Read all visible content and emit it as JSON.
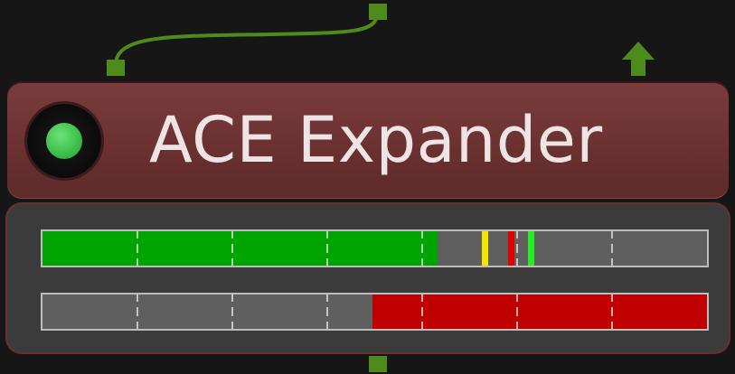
{
  "node": {
    "title": "ACE Expander",
    "status": "active",
    "colors": {
      "header": "#6e3333",
      "body": "#3b3b3b",
      "led_on": "#3fc24d",
      "wire": "#4f8a1c"
    }
  },
  "meters": {
    "level": {
      "fill_fraction": 0.595,
      "fill_color": "#00a400",
      "markers": [
        {
          "name": "threshold-marker",
          "position_fraction": 0.665,
          "color": "#f2e600"
        },
        {
          "name": "peak-marker",
          "position_fraction": 0.705,
          "color": "#e00000"
        },
        {
          "name": "current-marker",
          "position_fraction": 0.735,
          "color": "#22ee22"
        }
      ]
    },
    "gain_reduction": {
      "fill_fraction": 0.503,
      "fill_from": "right",
      "fill_color": "#c00000"
    },
    "tick_fractions": [
      0.143,
      0.286,
      0.429,
      0.571,
      0.714,
      0.857
    ]
  },
  "icons": {
    "output_arrow": "up-arrow-icon",
    "status_led": "led-icon"
  }
}
